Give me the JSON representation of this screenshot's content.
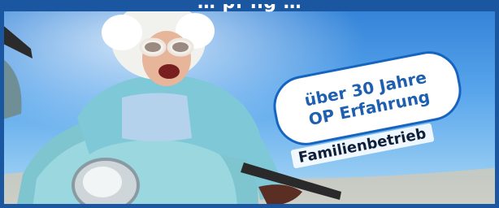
{
  "header": {
    "text": "… pf     ng …"
  },
  "badge": {
    "line1": "über 30 Jahre",
    "line2": "OP Erfahrung"
  },
  "tagline": "Familienbetrieb",
  "colors": {
    "frame": "#1b57a0",
    "badge_text": "#1e5fb0",
    "badge_border": "#1565c0"
  }
}
